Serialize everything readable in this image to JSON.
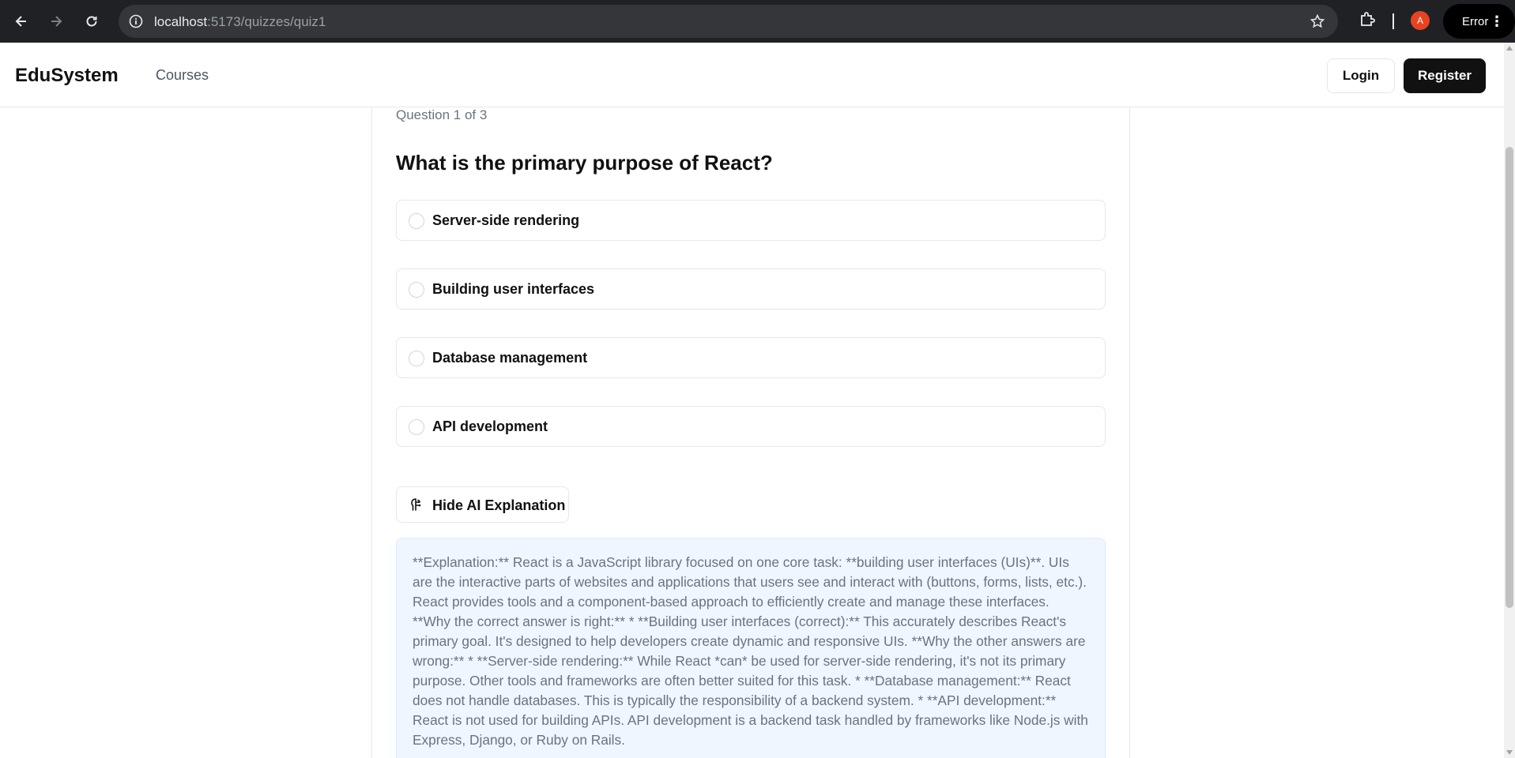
{
  "browser": {
    "url_host": "localhost",
    "url_path": ":5173/quizzes/quiz1",
    "profile_initial": "A",
    "error_label": "Error"
  },
  "header": {
    "brand": "EduSystem",
    "nav_courses": "Courses",
    "login": "Login",
    "register": "Register"
  },
  "quiz": {
    "progress": "Question 1 of 3",
    "question": "What is the primary purpose of React?",
    "options": [
      "Server-side rendering",
      "Building user interfaces",
      "Database management",
      "API development"
    ],
    "ai_button": "Hide AI Explanation",
    "explanation": "**Explanation:** React is a JavaScript library focused on one core task: **building user interfaces (UIs)**. UIs are the interactive parts of websites and applications that users see and interact with (buttons, forms, lists, etc.). React provides tools and a component-based approach to efficiently create and manage these interfaces. **Why the correct answer is right:** * **Building user interfaces (correct):** This accurately describes React's primary goal. It's designed to help developers create dynamic and responsive UIs. **Why the other answers are wrong:** * **Server-side rendering:** While React *can* be used for server-side rendering, it's not its primary purpose. Other tools and frameworks are often better suited for this task. * **Database management:** React does not handle databases. This is typically the responsibility of a backend system. * **API development:** React is not used for building APIs. API development is a backend task handled by frameworks like Node.js with Express, Django, or Ruby on Rails."
  }
}
